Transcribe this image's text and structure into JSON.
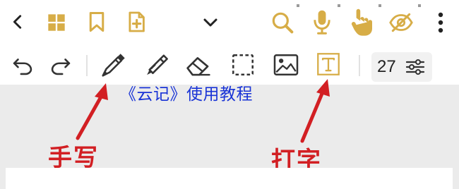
{
  "topbar": {
    "icons": [
      "chevron-left-icon",
      "grid-icon",
      "bookmark-icon",
      "add-page-icon",
      "chevron-down-icon",
      "search-icon",
      "microphone-icon",
      "touch-icon",
      "eye-off-icon",
      "more-vertical-icon"
    ]
  },
  "toolbar": {
    "icons": [
      "undo-icon",
      "redo-icon",
      "pen-icon",
      "highlighter-icon",
      "eraser-icon",
      "lasso-select-icon",
      "image-icon",
      "text-icon"
    ],
    "font_size": "27",
    "font_size_icon": "sliders-icon"
  },
  "overlay": {
    "title": "《云记》使用教程"
  },
  "annotations": {
    "handwriting": "手写",
    "typing": "打字",
    "color": "#d21f23"
  },
  "colors": {
    "accent": "#d7ad47",
    "icon_dark": "#333333",
    "title_blue": "#1a34d6",
    "background": "#ebebeb"
  }
}
